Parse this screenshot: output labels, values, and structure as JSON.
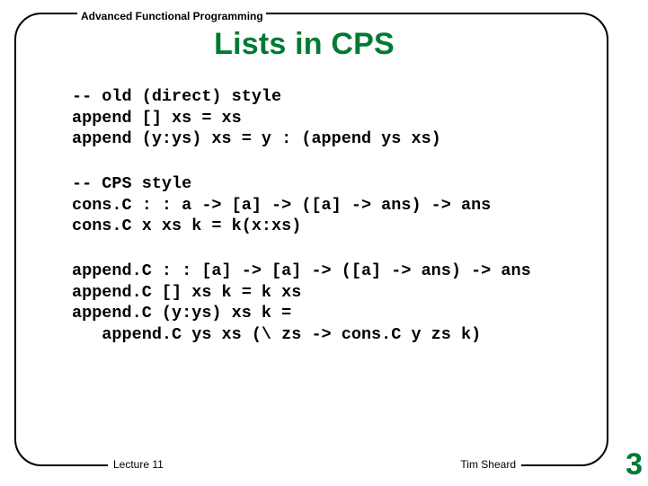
{
  "header": {
    "course": "Advanced Functional Programming"
  },
  "title": "Lists in CPS",
  "code": {
    "block1": "-- old (direct) style\nappend [] xs = xs\nappend (y:ys) xs = y : (append ys xs)",
    "block2": "-- CPS style\ncons.C : : a -> [a] -> ([a] -> ans) -> ans\ncons.C x xs k = k(x:xs)",
    "block3": "append.C : : [a] -> [a] -> ([a] -> ans) -> ans\nappend.C [] xs k = k xs\nappend.C (y:ys) xs k =\n   append.C ys xs (\\ zs -> cons.C y zs k)"
  },
  "footer": {
    "lecture": "Lecture 11",
    "author": "Tim Sheard"
  },
  "page": "3"
}
